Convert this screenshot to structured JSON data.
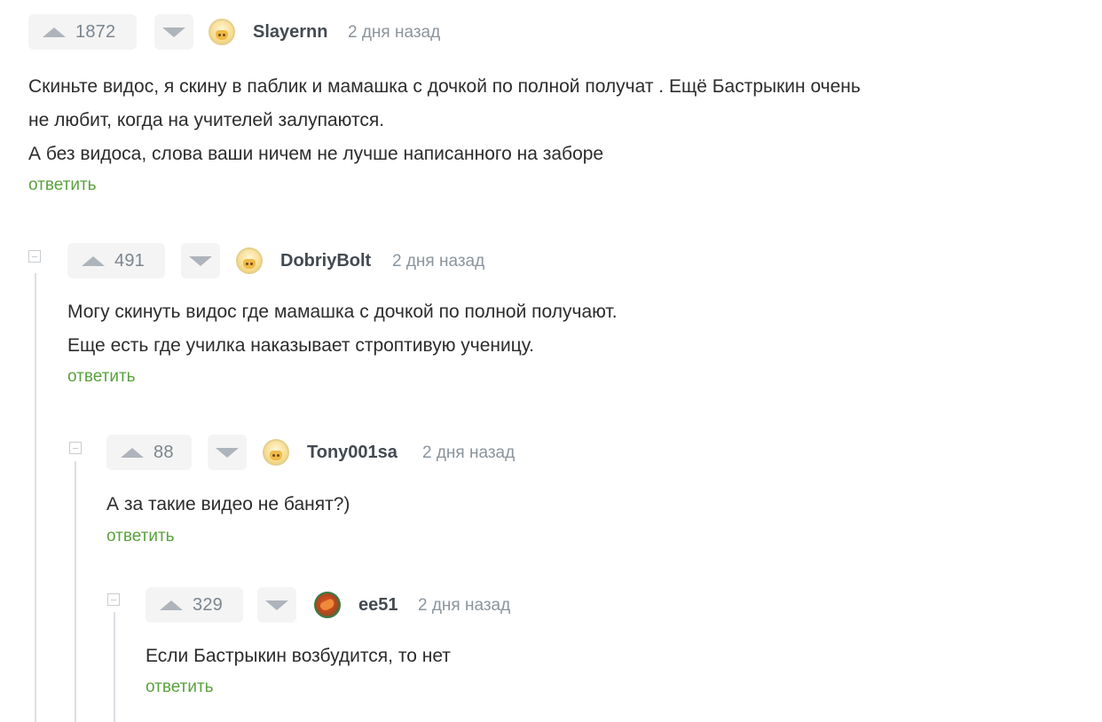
{
  "comments": [
    {
      "rating": "1872",
      "author": "Slayernn",
      "time": "2 дня назад",
      "lines": [
        "Скиньте видос, я скину в паблик и мамашка с дочкой по полной получат . Ещё Бастрыкин очень",
        "не любит, когда на учителей залупаются.",
        "А без видоса, слова ваши ничем не лучше написанного на заборе"
      ],
      "reply": "ответить",
      "avatar_icon": "smiling-creature-avatar-icon"
    },
    {
      "rating": "491",
      "author": "DobriyBolt",
      "time": "2 дня назад",
      "lines": [
        "Могу скинуть видос где мамашка с дочкой по полной получают.",
        "Еще есть где училка наказывает строптивую ученицу."
      ],
      "reply": "ответить",
      "avatar_icon": "smiling-creature-avatar-icon"
    },
    {
      "rating": "88",
      "author": "Tony001sa",
      "time": "2 дня назад",
      "lines": [
        "А за такие видео не банят?)"
      ],
      "reply": "ответить",
      "avatar_icon": "smiling-creature-avatar-icon"
    },
    {
      "rating": "329",
      "author": "ee51",
      "time": "2 дня назад",
      "lines": [
        "Если Бастрыкин возбудится, то нет"
      ],
      "reply": "ответить",
      "avatar_icon": "custom-avatar-icon"
    }
  ],
  "colors": {
    "reply_link": "#5aa23d",
    "username": "#434a51",
    "timestamp": "#8a949c",
    "vote_bg": "#f4f4f4"
  }
}
